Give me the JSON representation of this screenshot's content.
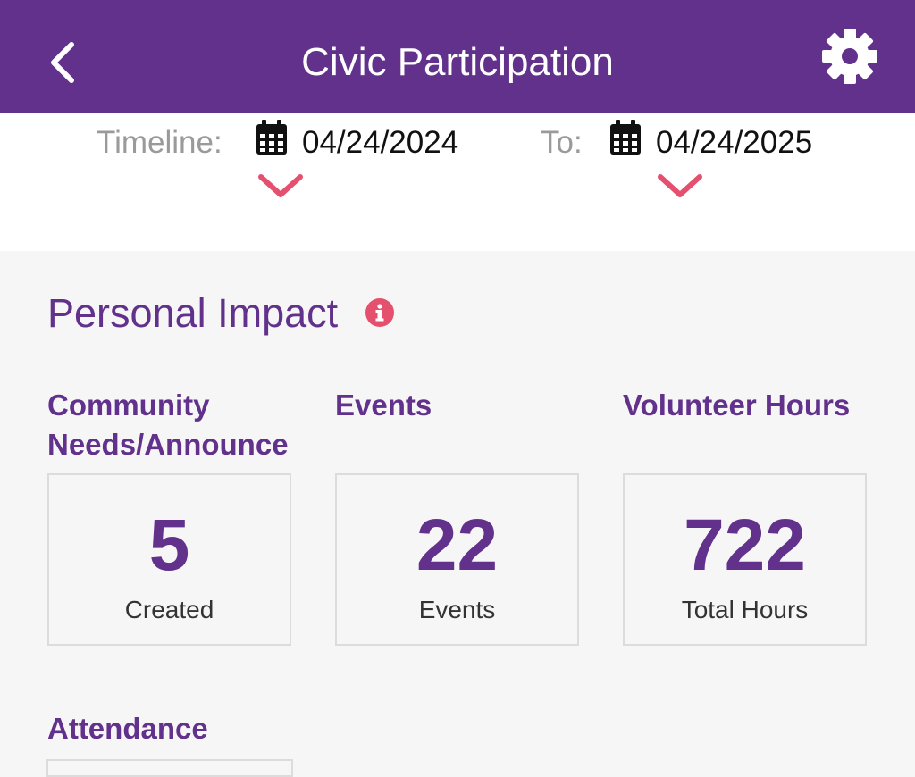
{
  "colors": {
    "primary": "#62318c",
    "accent": "#e5506e",
    "header_text": "#ffffff"
  },
  "header": {
    "title": "Civic Participation",
    "back_icon": "chevron-left-icon",
    "settings_icon": "gear-icon"
  },
  "timeline": {
    "label": "Timeline:",
    "start_date": "04/24/2024",
    "to_label": "To:",
    "end_date": "04/24/2025",
    "calendar_icon": "calendar-icon",
    "dropdown_icon": "chevron-down-icon"
  },
  "personal_impact": {
    "title": "Personal Impact",
    "info_icon": "info-icon",
    "stats": [
      {
        "heading": "Community Needs/Announce",
        "heading_line1": "Community",
        "heading_line2": "Needs/Announce",
        "value": "5",
        "caption": "Created"
      },
      {
        "heading": "Events",
        "value": "22",
        "caption": "Events"
      },
      {
        "heading": "Volunteer Hours",
        "value": "722",
        "caption": "Total Hours"
      }
    ]
  },
  "attendance": {
    "title": "Attendance"
  }
}
